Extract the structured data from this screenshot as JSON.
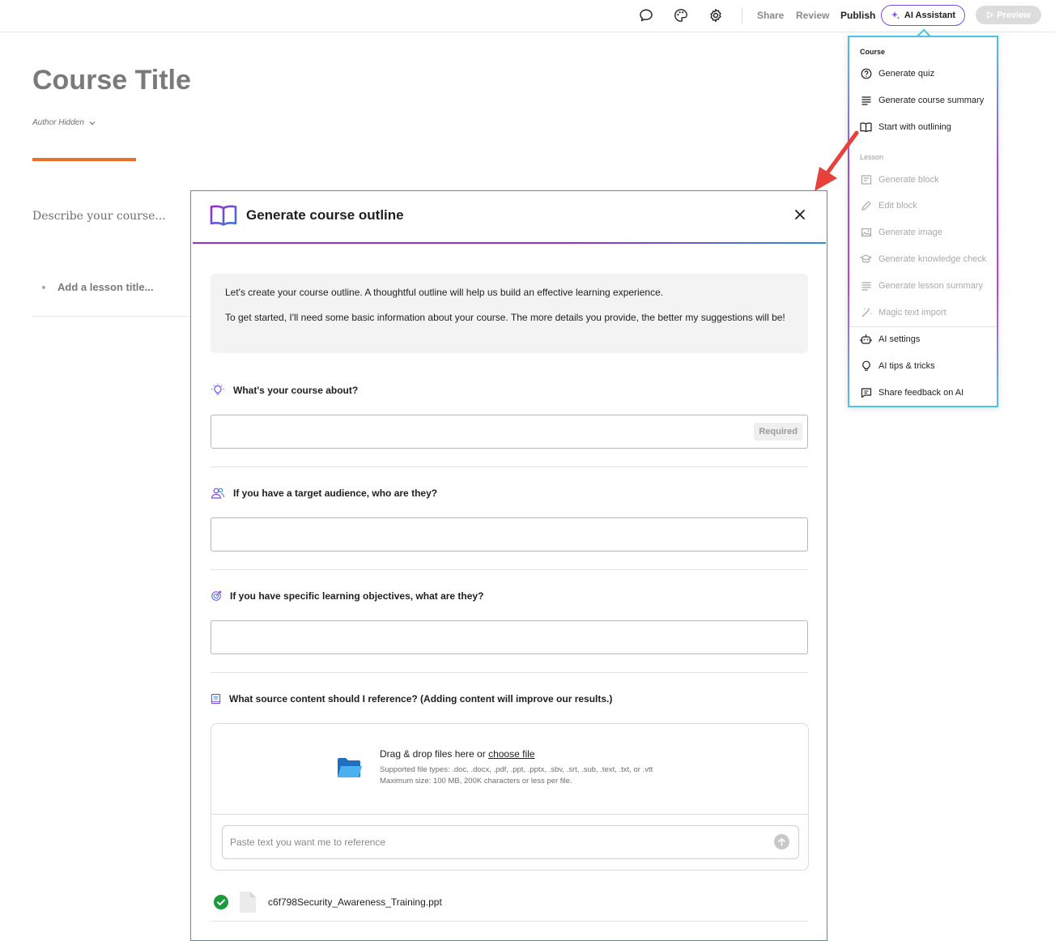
{
  "topbar": {
    "share_label": "Share",
    "review_label": "Review",
    "publish_label": "Publish",
    "ai_assistant_label": "AI Assistant",
    "preview_label": "Preview"
  },
  "page": {
    "course_title": "Course Title",
    "author": "Author Hidden",
    "description_placeholder": "Describe your course...",
    "lesson_placeholder": "Add a lesson title..."
  },
  "menu": {
    "course_section": "Course",
    "course_items": [
      {
        "label": "Generate quiz",
        "icon": "quiz-icon"
      },
      {
        "label": "Generate course summary",
        "icon": "summary-icon"
      },
      {
        "label": "Start with outlining",
        "icon": "book-icon"
      }
    ],
    "lesson_section": "Lesson",
    "lesson_items": [
      {
        "label": "Generate block",
        "icon": "block-icon"
      },
      {
        "label": "Edit block",
        "icon": "pencil-icon"
      },
      {
        "label": "Generate image",
        "icon": "image-icon"
      },
      {
        "label": "Generate knowledge check",
        "icon": "graduation-cap-icon"
      },
      {
        "label": "Generate lesson summary",
        "icon": "summary-icon"
      },
      {
        "label": "Magic text import",
        "icon": "magic-wand-icon"
      }
    ],
    "other_items": [
      {
        "label": "AI settings",
        "icon": "robot-icon"
      },
      {
        "label": "AI tips & tricks",
        "icon": "lightbulb-icon"
      },
      {
        "label": "Share feedback on AI",
        "icon": "feedback-icon"
      }
    ]
  },
  "modal": {
    "title": "Generate course outline",
    "intro_p1": "Let's create your course outline. A thoughtful outline will help us build an effective learning experience.",
    "intro_p2": "To get started, I'll need some basic information about your course. The more details you provide, the better my suggestions will be!",
    "q1_label": "What's your course about?",
    "q1_badge": "Required",
    "q2_label": "If you have a target audience, who are they?",
    "q3_label": "If you have specific learning objectives, what are they?",
    "q4_label": "What source content should I reference? (Adding content will improve our results.)",
    "drop_text": "Drag & drop files here or",
    "choose_file": "choose file",
    "file_types": "Supported file types: .doc, .docx, .pdf, .ppt, .pptx, .sbv, .srt, .sub, .text, .txt, or .vtt",
    "max_size": "Maximum size: 100 MB, 200K characters or less per file.",
    "paste_placeholder": "Paste text you want me to reference",
    "uploaded_file": "c6f798Security_Awareness_Training.ppt"
  },
  "colors": {
    "accent_orange": "#e9702c",
    "ai_purple": "#7b4de6",
    "modal_border": "#2fa3ac",
    "success_green": "#1a9a3a",
    "arrow_red": "#e8403a"
  }
}
